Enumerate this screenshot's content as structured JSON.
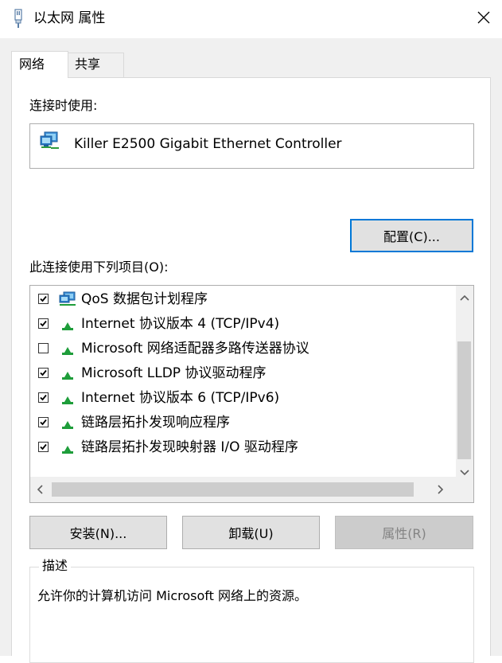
{
  "window": {
    "title": "以太网 属性"
  },
  "tabs": [
    {
      "label": "网络",
      "active": true
    },
    {
      "label": "共享",
      "active": false
    }
  ],
  "connect_using": {
    "label": "连接时使用:",
    "adapter_name": "Killer E2500 Gigabit Ethernet Controller",
    "configure_button": "配置(C)..."
  },
  "items_section": {
    "label": "此连接使用下列项目(O):",
    "items": [
      {
        "checked": true,
        "icon": "qos-network-icon",
        "label": "QoS 数据包计划程序"
      },
      {
        "checked": true,
        "icon": "protocol-icon",
        "label": "Internet 协议版本 4 (TCP/IPv4)"
      },
      {
        "checked": false,
        "icon": "protocol-icon",
        "label": "Microsoft 网络适配器多路传送器协议"
      },
      {
        "checked": true,
        "icon": "protocol-icon",
        "label": "Microsoft LLDP 协议驱动程序"
      },
      {
        "checked": true,
        "icon": "protocol-icon",
        "label": "Internet 协议版本 6 (TCP/IPv6)"
      },
      {
        "checked": true,
        "icon": "protocol-icon",
        "label": "链路层拓扑发现响应程序"
      },
      {
        "checked": true,
        "icon": "protocol-icon",
        "label": "链路层拓扑发现映射器 I/O 驱动程序"
      }
    ]
  },
  "buttons": {
    "install": "安装(N)...",
    "uninstall": "卸载(U)",
    "properties": "属性(R)"
  },
  "description": {
    "title": "描述",
    "text": "允许你的计算机访问 Microsoft 网络上的资源。"
  },
  "colors": {
    "accent": "#0078d7",
    "protocol_icon_green": "#1e9d3a"
  }
}
